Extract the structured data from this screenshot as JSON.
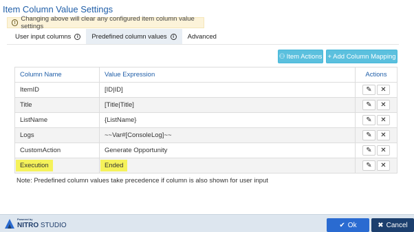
{
  "dialog": {
    "title": "Item Column Value Settings",
    "warning": "Changing above will clear any configured item column value settings"
  },
  "tabs": [
    {
      "label": "User input columns",
      "active": false
    },
    {
      "label": "Predefined column values",
      "active": true
    },
    {
      "label": "Advanced",
      "active": false
    }
  ],
  "toolbar": {
    "item_actions_label": "Item Actions",
    "add_mapping_label": "+ Add Column Mapping"
  },
  "table": {
    "headers": [
      "Column Name",
      "Value Expression",
      "Actions"
    ],
    "rows": [
      {
        "column": "ItemID",
        "value": "[ID|ID]"
      },
      {
        "column": "Title",
        "value": "[Title|Title]"
      },
      {
        "column": "ListName",
        "value": "{ListName}"
      },
      {
        "column": "Logs",
        "value": "~~Var#[ConsoleLog]~~"
      },
      {
        "column": "CustomAction",
        "value": "Generate Opportunity"
      },
      {
        "column": "Execution",
        "value": "Ended",
        "highlighted": true
      }
    ]
  },
  "note": "Note: Predefined column values take precedence if column is also shown for user input",
  "footer": {
    "powered_by": "Powered by",
    "brand_bold": "NITRO",
    "brand_rest": " STUDIO",
    "ok_label": "Ok",
    "cancel_label": "Cancel"
  },
  "colors": {
    "accent": "#1f5ea8",
    "teal": "#5bc0de",
    "ok": "#2a6bd1",
    "cancel": "#1c3f6e",
    "highlight": "#f5f25a"
  }
}
